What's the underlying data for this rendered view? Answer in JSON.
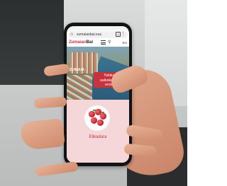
{
  "browser": {
    "url": "zumaiaobai.eus",
    "menu_icon": "more-vert-icon",
    "home_icon": "home-icon",
    "tabs_count": "1"
  },
  "site": {
    "logo_main": "Zumaian",
    "logo_accent": "Bai",
    "search_icon": "search-icon",
    "menu_icon": "hamburger-menu-icon",
    "language": "EU"
  },
  "hero": {
    "place_label": "ZUMAIA",
    "card_line1": "Tokiko",
    "card_line2": "saltokietan",
    "card_line3": "erosi",
    "accent_color": "#c8323c"
  },
  "section": {
    "label": "Elikadura",
    "background": "#f5d7da"
  }
}
